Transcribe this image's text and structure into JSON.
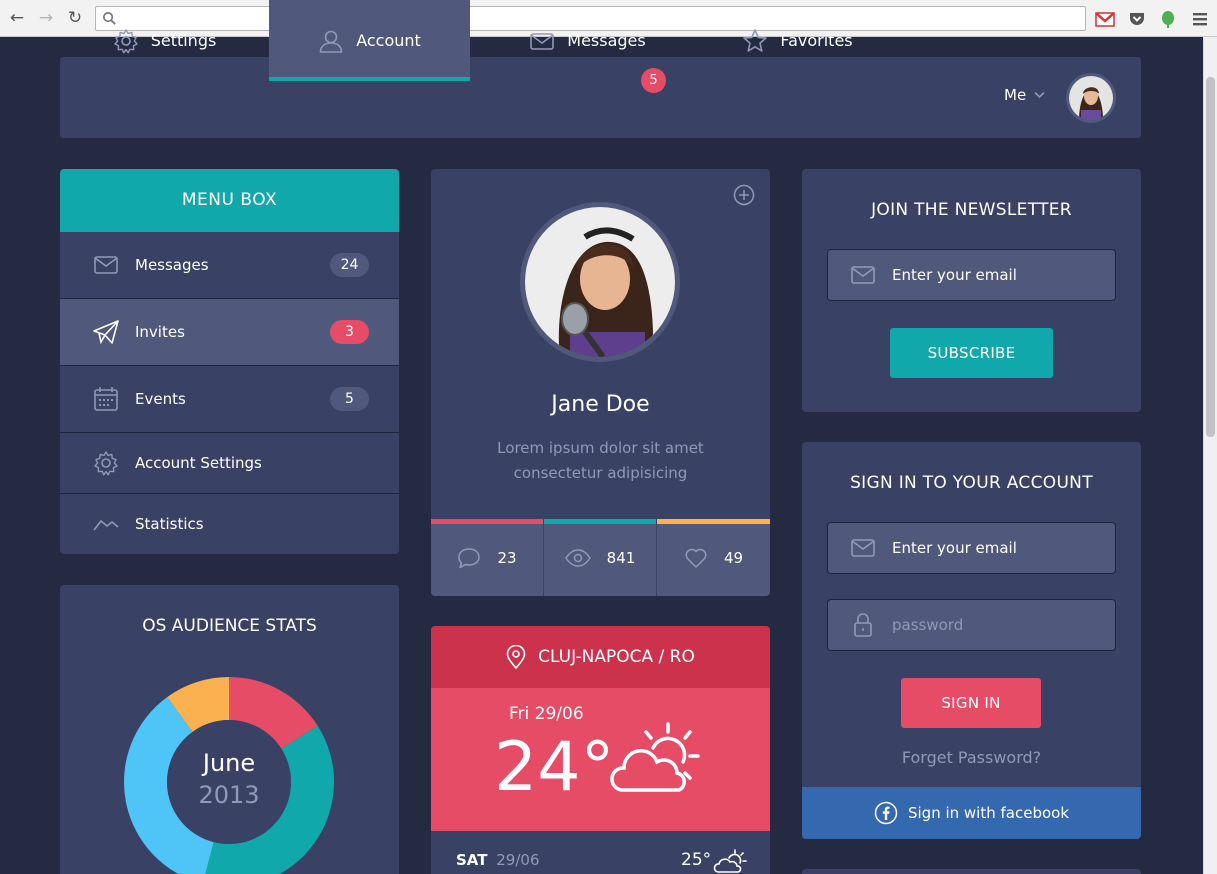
{
  "browser": {
    "url": ""
  },
  "topnav": {
    "tabs": [
      {
        "label": "Settings",
        "icon": "gear-icon"
      },
      {
        "label": "Account",
        "icon": "user-icon",
        "active": true
      },
      {
        "label": "Messages",
        "icon": "envelope-icon",
        "badge": "5"
      },
      {
        "label": "Favorites",
        "icon": "star-icon"
      }
    ],
    "me_label": "Me"
  },
  "menu_box": {
    "title": "MENU BOX",
    "items": [
      {
        "label": "Messages",
        "count": "24",
        "icon": "envelope-icon"
      },
      {
        "label": "Invites",
        "count": "3",
        "icon": "paper-plane-icon",
        "active": true
      },
      {
        "label": "Events",
        "count": "5",
        "icon": "calendar-icon"
      },
      {
        "label": "Account Settings",
        "count": "",
        "icon": "gear-icon"
      },
      {
        "label": "Statistics",
        "count": "",
        "icon": "chart-line-icon"
      }
    ]
  },
  "profile": {
    "name": "Jane Doe",
    "desc_line1": "Lorem ipsum dolor sit amet",
    "desc_line2": "consectetur adipisicing",
    "stats": [
      {
        "icon": "comment-icon",
        "value": "23",
        "color": "#e64c65"
      },
      {
        "icon": "eye-icon",
        "value": "841",
        "color": "#11a8ab"
      },
      {
        "icon": "heart-icon",
        "value": "49",
        "color": "#fcb150"
      }
    ]
  },
  "weather": {
    "location": "CLUJ-NAPOCA / RO",
    "date": "Fri 29/06",
    "temperature": "24°",
    "forecast": [
      {
        "day": "SAT",
        "date": "29/06",
        "temp": "25°"
      }
    ]
  },
  "newsletter": {
    "title": "JOIN THE NEWSLETTER",
    "email_placeholder": "Enter your email",
    "button": "SUBSCRIBE"
  },
  "signin": {
    "title": "SIGN IN TO YOUR ACCOUNT",
    "email_placeholder": "Enter your email",
    "password_placeholder": "password",
    "button": "SIGN IN",
    "forgot": "Forget Password?",
    "facebook": "Sign in with facebook"
  },
  "audience": {
    "title": "OS AUDIENCE STATS",
    "month": "June",
    "year": "2013"
  },
  "chart_data": {
    "type": "pie",
    "categories": [
      "",
      "",
      "",
      ""
    ],
    "values": [
      16,
      38,
      36,
      10
    ],
    "colors": [
      "#e64c65",
      "#11a8ab",
      "#4fc4f6",
      "#fcb150"
    ]
  },
  "colors": {
    "background": "#242a42",
    "panel": "#394264",
    "panel_light": "#50597b",
    "teal": "#11a8ab",
    "red": "#e64c65",
    "facebook": "#3468af"
  }
}
